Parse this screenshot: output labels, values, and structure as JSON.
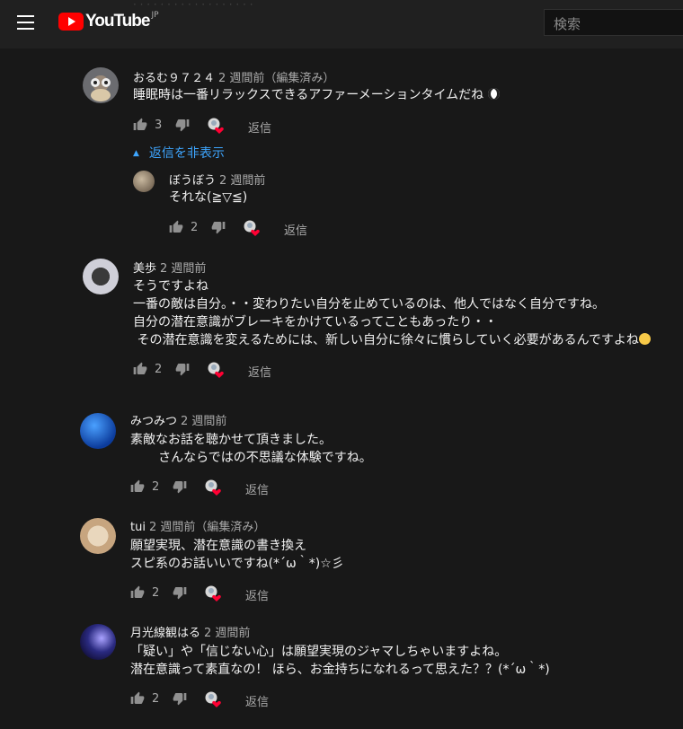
{
  "header": {
    "logo_text": "YouTube",
    "logo_region": "JP",
    "search_placeholder": "検索"
  },
  "comments": [
    {
      "author": "おるむ９７２４",
      "time": "2 週間前（編集済み）",
      "text": "睡眠時は一番リラックスできるアファーメーションタイムだね",
      "likes": "3",
      "reply_label": "返信"
    },
    {
      "author": "美歩",
      "time": "2 週間前",
      "text": "そうですよね\n一番の敵は自分。・・変わりたい自分を止めているのは、他人ではなく自分ですね。\n自分の潜在意識がブレーキをかけているってこともあったり・・\n その潜在意識を変えるためには、新しい自分に徐々に慣らしていく必要があるんですよね",
      "likes": "2",
      "reply_label": "返信"
    },
    {
      "author": "みつみつ",
      "time": "2 週間前",
      "text": "素敵なお話を聴かせて頂きました。\n       さんならではの不思議な体験ですね。",
      "likes": "2",
      "reply_label": "返信"
    },
    {
      "author": "tui",
      "time": "2 週間前（編集済み）",
      "text": "願望実現、潜在意識の書き換え\nスピ系のお話いいですね(*´ω｀*)☆彡",
      "likes": "2",
      "reply_label": "返信"
    },
    {
      "author": "月光線観はる",
      "time": "2 週間前",
      "text": "「疑い」や「信じない心」は願望実現のジャマしちゃいますよね。\n潜在意識って素直なの！ ほら、お金持ちになれるって思えた？？(*´ω｀*)",
      "likes": "2",
      "reply_label": "返信"
    }
  ],
  "replies_toggle": "返信を非表示",
  "reply": {
    "author": "ぼうぼう",
    "time": "2 週間前",
    "text": "それな(≧▽≦)",
    "likes": "2",
    "reply_label": "返信"
  },
  "colors": {
    "background": "#181818",
    "header": "#202020",
    "link": "#3ea6ff",
    "heart": "#ff0033",
    "logo_red": "#ff0000"
  }
}
